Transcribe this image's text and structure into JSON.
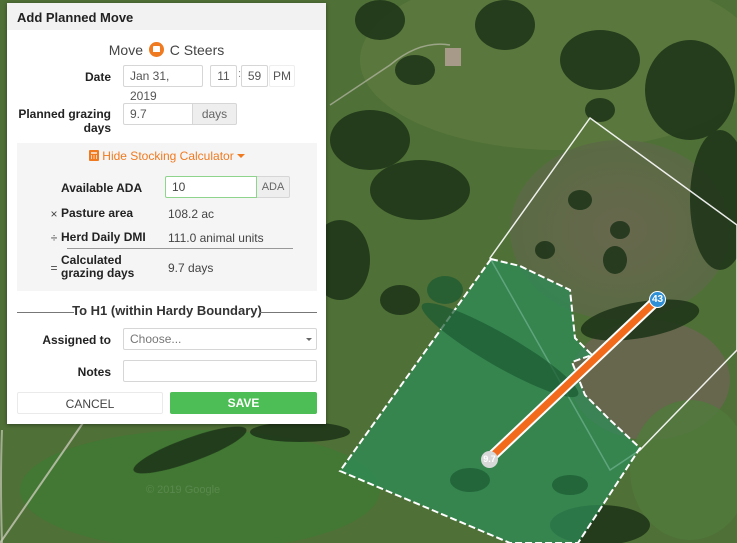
{
  "dialog": {
    "title": "Add Planned Move",
    "move_prefix": "Move",
    "herd_icon": "cow-head-icon",
    "herd_name": "C Steers",
    "date_label": "Date",
    "date_value": "Jan 31, 2019",
    "hour_value": "11",
    "time_separator": ":",
    "minute_value": "59",
    "ampm": "PM",
    "grazing_label": "Planned grazing days",
    "grazing_value": "9.7",
    "grazing_unit": "days"
  },
  "calculator": {
    "toggle_icon": "calculator-icon",
    "toggle_label": "Hide Stocking Calculator",
    "ada_label": "Available ADA",
    "ada_value": "10",
    "ada_unit": "ADA",
    "pasture_op": "×",
    "pasture_label": "Pasture area",
    "pasture_value": "108.2 ac",
    "dmi_op": "÷",
    "dmi_label": "Herd Daily DMI",
    "dmi_value": "111.0 animal units",
    "result_op": "=",
    "result_label": "Calculated grazing days",
    "result_value": "9.7 days"
  },
  "destination": {
    "title": "To H1 (within Hardy Boundary)",
    "assigned_label": "Assigned to",
    "assigned_placeholder": "Choose...",
    "notes_label": "Notes",
    "notes_value": ""
  },
  "actions": {
    "cancel_label": "CANCEL",
    "save_label": "SAVE"
  },
  "map": {
    "start_marker": "9.7",
    "end_marker": "43",
    "route_color": "#f26b1d",
    "end_marker_color": "#2e8fd6",
    "pasture_fill": "#2e8b57",
    "watermark": "© 2019 Google"
  }
}
